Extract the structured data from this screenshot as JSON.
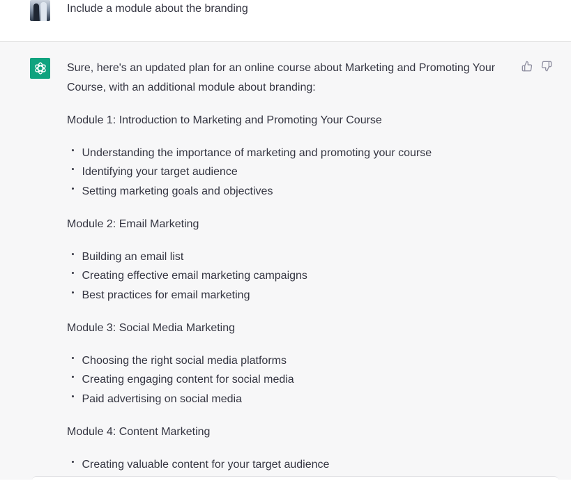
{
  "user_message": {
    "text": "Include a module about the branding"
  },
  "assistant_message": {
    "intro": "Sure, here's an updated plan for an online course about Marketing and Promoting Your Course, with an additional module about branding:",
    "modules": [
      {
        "title": "Module 1: Introduction to Marketing and Promoting Your Course",
        "items": [
          "Understanding the importance of marketing and promoting your course",
          "Identifying your target audience",
          "Setting marketing goals and objectives"
        ]
      },
      {
        "title": "Module 2: Email Marketing",
        "items": [
          "Building an email list",
          "Creating effective email marketing campaigns",
          "Best practices for email marketing"
        ]
      },
      {
        "title": "Module 3: Social Media Marketing",
        "items": [
          "Choosing the right social media platforms",
          "Creating engaging content for social media",
          "Paid advertising on social media"
        ]
      },
      {
        "title": "Module 4: Content Marketing",
        "items": [
          "Creating valuable content for your target audience"
        ]
      }
    ]
  },
  "icons": {
    "assistant_avatar": "openai-logo-icon",
    "thumbs_up": "thumbs-up-icon",
    "thumbs_down": "thumbs-down-icon"
  },
  "colors": {
    "assistant_avatar_bg": "#10a37f",
    "assistant_row_bg": "#f7f7f8",
    "text": "#343541"
  }
}
